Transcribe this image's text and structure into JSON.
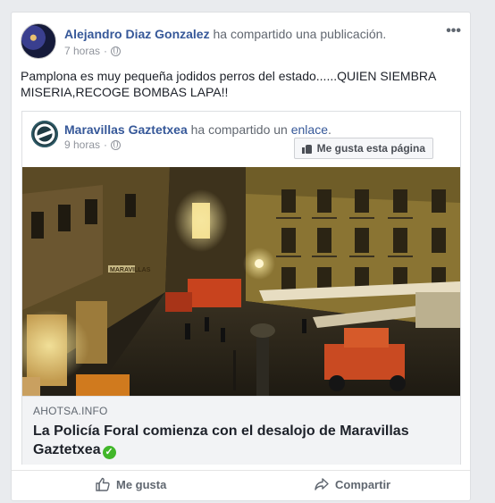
{
  "post": {
    "author": "Alejandro Diaz Gonzalez",
    "action": " ha compartido una publicación.",
    "time": "7 horas",
    "meta_separator": "·",
    "text": "Pamplona es muy pequeña jodidos perros del estado......QUIEN SIEMBRA MISERIA,RECOGE BOMBAS LAPA!!"
  },
  "shared": {
    "page_name": "Maravillas Gaztetxea",
    "action": " ha compartido un ",
    "link_word": "enlace",
    "period": ".",
    "time": "9 horas",
    "meta_separator": "·",
    "like_page_label": "Me gusta esta página"
  },
  "link": {
    "domain": "AHOTSA.INFO",
    "title": "La Policía Foral comienza con el desalojo de Maravillas Gaztetxea",
    "verified_symbol": "✓"
  },
  "actions": {
    "like_label": "Me gusta",
    "share_label": "Compartir"
  },
  "image_signage": {
    "shop_sign": "MARAVILLAS"
  },
  "icons": {
    "more": "more-options-icon",
    "privacy": "globe-icon",
    "like": "thumbs-up-icon",
    "share": "share-arrow-icon",
    "verified": "verified-check-icon"
  },
  "colors": {
    "link_blue": "#365899",
    "muted": "#90949c",
    "verified_green": "#42b72a",
    "background": "#e9ebee"
  }
}
